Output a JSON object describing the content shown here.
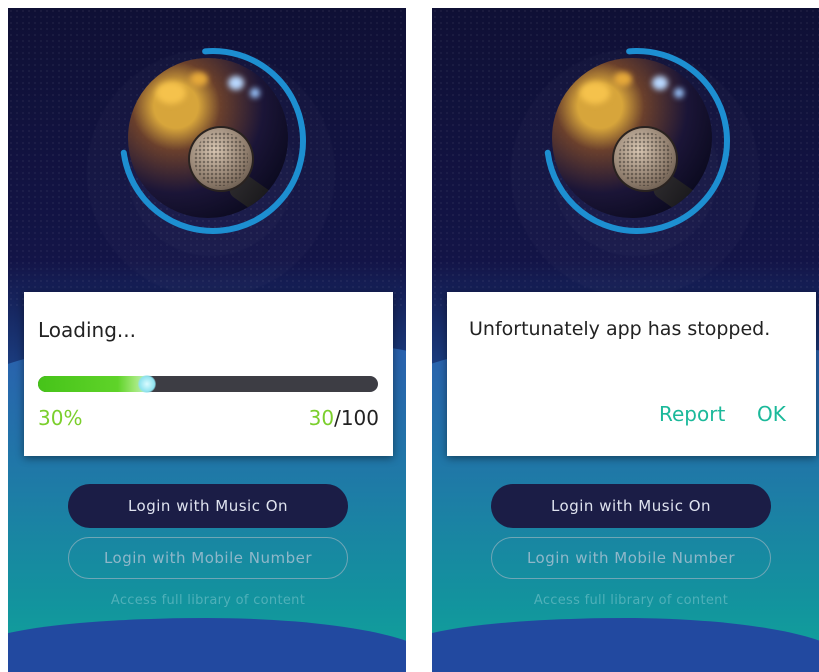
{
  "left_screen": {
    "dialog": {
      "title": "Loading...",
      "progress_percent_text": "30%",
      "progress_fraction": 0.3,
      "count_current": "30",
      "count_total": "/100"
    },
    "buttons": {
      "primary": "Login with Music On",
      "secondary": "Login with Mobile Number"
    },
    "access_text": "Access full library of content"
  },
  "right_screen": {
    "dialog": {
      "message": "Unfortunately app has stopped.",
      "report_label": "Report",
      "ok_label": "OK"
    },
    "buttons": {
      "primary": "Login with Music On",
      "secondary": "Login with Mobile Number"
    },
    "access_text": "Access full library of content"
  },
  "colors": {
    "accent_green": "#7bcf2c",
    "dialog_button": "#1bb99a",
    "ring": "#1d8fd1"
  },
  "icons": {
    "hero": "microphone-image"
  }
}
